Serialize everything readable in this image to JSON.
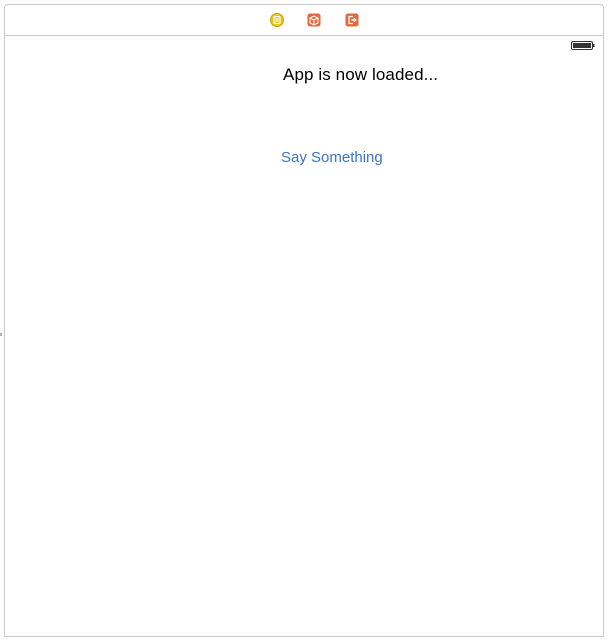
{
  "scene_dock": {
    "icons": [
      {
        "name": "view-controller-icon",
        "color": "#e8c317"
      },
      {
        "name": "first-responder-icon",
        "color": "#e06a3b"
      },
      {
        "name": "exit-icon",
        "color": "#e06a3b"
      }
    ]
  },
  "view": {
    "status_label": "App is now loaded...",
    "button_label": "Say Something",
    "button_color": "#3c75c4"
  }
}
